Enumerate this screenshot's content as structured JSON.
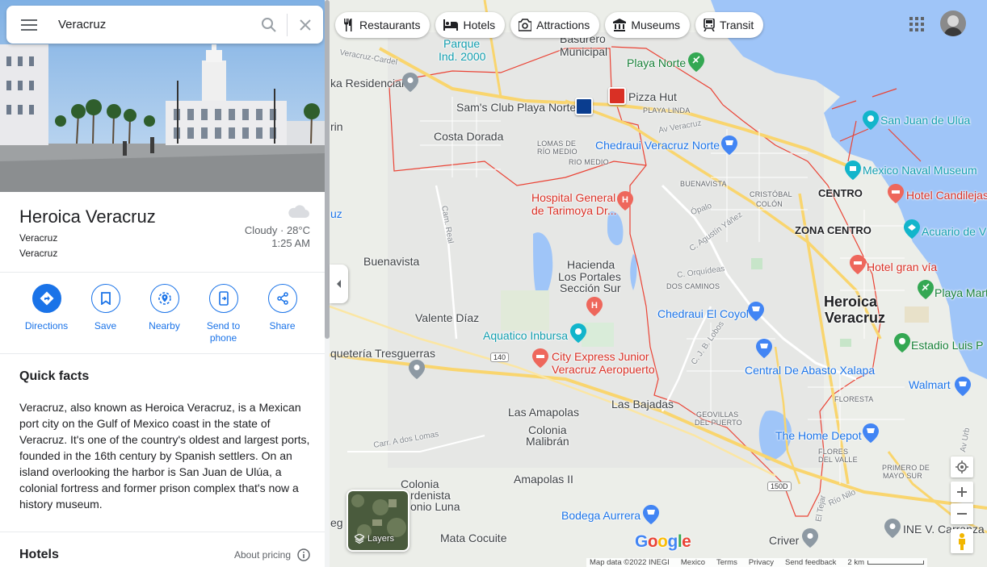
{
  "search": {
    "query": "Veracruz"
  },
  "place": {
    "title": "Heroica Veracruz",
    "subtitle_1": "Veracruz",
    "subtitle_2": "Veracruz",
    "weather": "Cloudy · 28°C",
    "time": "1:25 AM"
  },
  "actions": [
    {
      "label": "Directions",
      "icon": "directions-icon"
    },
    {
      "label": "Save",
      "icon": "bookmark-icon"
    },
    {
      "label": "Nearby",
      "icon": "nearby-icon"
    },
    {
      "label": "Send to phone",
      "icon": "send-to-phone-icon"
    },
    {
      "label": "Share",
      "icon": "share-icon"
    }
  ],
  "quick_facts": {
    "heading": "Quick facts",
    "text": "Veracruz, also known as Heroica Veracruz, is a Mexican port city on the Gulf of Mexico coast in the state of Veracruz. It's one of the country's oldest and largest ports, founded in the 16th century by Spanish settlers. On an island overlooking the harbor is San Juan de Ulúa, a colonial fortress and former prison complex that's now a history museum."
  },
  "hotels": {
    "heading": "Hotels",
    "about_pricing": "About pricing"
  },
  "chips": [
    {
      "label": "Restaurants",
      "icon": "fork-knife-icon"
    },
    {
      "label": "Hotels",
      "icon": "bed-icon"
    },
    {
      "label": "Attractions",
      "icon": "camera-icon"
    },
    {
      "label": "Museums",
      "icon": "museum-icon"
    },
    {
      "label": "Transit",
      "icon": "train-icon"
    }
  ],
  "map_labels": {
    "parque": "Parque",
    "ind2000": "Ind. 2000",
    "basurero": "Basurero",
    "municipal": "Municipal",
    "playa_norte": "Playa Norte",
    "ka_residencial": "ka Residencial",
    "sams": "Sam's Club Playa Norte",
    "pizza_hut": "Pizza Hut",
    "playa_linda": "PLAYA LINDA",
    "san_juan": "San Juan de Ulúa",
    "costa_dorada": "Costa Dorada",
    "lomas1": "LOMAS DE",
    "lomas2": "RÍO MEDIO",
    "rio_medio": "RIO MEDIO",
    "chedraui_norte": "Chedraui Veracruz Norte",
    "naval": "Mexico Naval Museum",
    "buenavista_caps": "BUENAVISTA",
    "cristobal1": "CRISTÓBAL",
    "cristobal2": "COLÓN",
    "centro": "CENTRO",
    "candilejas": "Hotel Candilejas",
    "hospital1": "Hospital General",
    "hospital2": "de Tarimoya Dr...",
    "acuario": "Acuario de V",
    "zona_centro": "ZONA CENTRO",
    "buenavista": "Buenavista",
    "hacienda1": "Hacienda",
    "hacienda2": "Los Portales",
    "hacienda3": "Sección Sur",
    "hotel_gran_via": "Hotel gran vía",
    "dos_caminos": "DOS CAMINOS",
    "heroica1": "Heroica",
    "heroica2": "Veracruz",
    "playa_mart": "Playa Mart",
    "chedraui_coyol": "Chedraui El Coyol",
    "valente": "Valente Díaz",
    "aquatico": "Aquatico Inbursa",
    "quetería": "quetería Tresguerras",
    "city_express1": "City Express Junior",
    "city_express2": "Veracruz Aeropuerto",
    "estadio": "Estadio Luis P",
    "central_abasto": "Central De Abasto Xalapa",
    "walmart": "Walmart",
    "las_bajadas": "Las Bajadas",
    "las_amapolas": "Las Amapolas",
    "floresta": "FLORESTA",
    "geovillas1": "GEOVILLAS",
    "geovillas2": "DEL PUERTO",
    "colonia1": "Colonia",
    "colonia2": "Malibrán",
    "home_depot": "The Home Depot",
    "flores1": "FLORES",
    "flores2": "DEL VALLE",
    "primero1": "PRIMERO DE",
    "primero2": "MAYO SUR",
    "colonia_luna1": "Colonia",
    "colonia_luna2": "rdenista",
    "colonia_luna3": "onio Luna",
    "amapolas2": "Amapolas II",
    "bodega": "Bodega Aurrera",
    "criver": "Criver",
    "ine": "INE V. Carranza",
    "mata": "Mata Cocuite",
    "rin": "rin",
    "uz": "uz",
    "rd_cardel": "Veracruz-Cardel",
    "rd_cam_real": "Cam. Real",
    "rd_av_veracruz": "Av Veracruz",
    "rd_opalo": "Ópalo",
    "rd_agustin": "C. Agustín Yáñez",
    "rd_orquideas": "C. Orquídeas",
    "rd_lobos": "C. J. B. Lobos",
    "rd_140": "140",
    "rd_150d": "150D",
    "rd_carr_lomas": "Carr. A dos Lomas",
    "rd_rio_nilo": "Río Nilo",
    "rd_el_tejar": "El Tejar",
    "rd_av_urban": "Av Urb",
    "rd_ceg": "eg"
  },
  "layers_label": "Layers",
  "google_logo": "Google",
  "footer": {
    "map_data": "Map data ©2022 INEGI",
    "mexico": "Mexico",
    "terms": "Terms",
    "privacy": "Privacy",
    "feedback": "Send feedback",
    "scale": "2 km"
  },
  "colors": {
    "accent": "#1a73e8",
    "water": "#9fc5f8",
    "boundary": "#ea4335",
    "highway": "#f9d56e",
    "park": "#c7e5c9"
  }
}
